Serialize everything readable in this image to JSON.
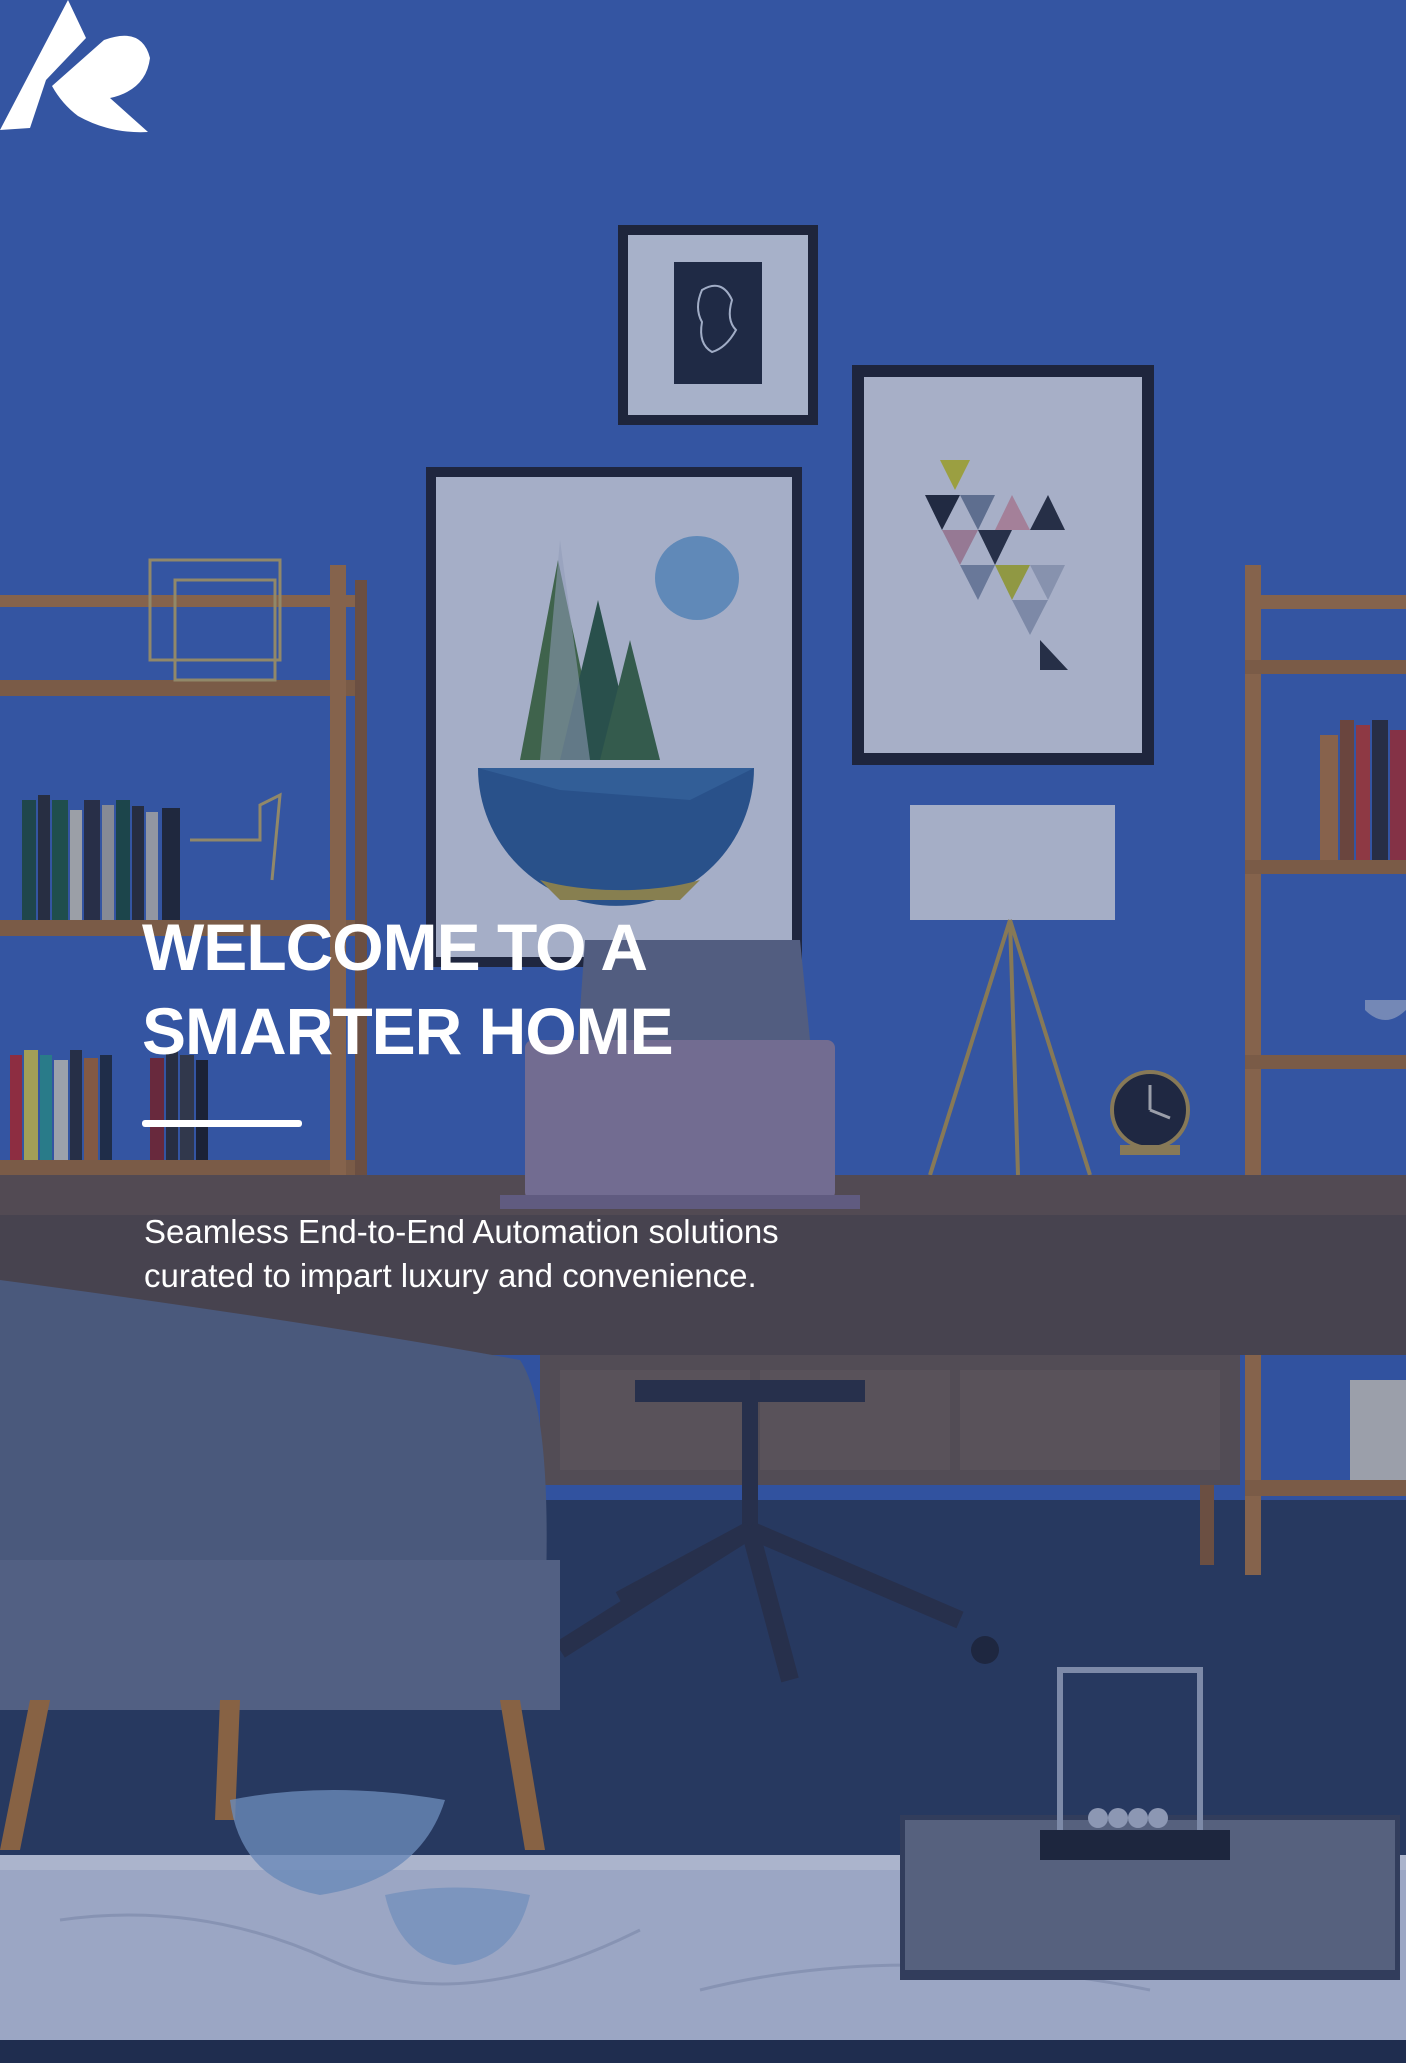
{
  "hero": {
    "headline_line1": "WELCOME TO A",
    "headline_line2": "SMARTER HOME",
    "tagline_line1": "Seamless End-to-End Automation solutions",
    "tagline_line2": "curated to impart luxury and convenience."
  },
  "logo": {
    "icon": "stylized-a-logo-icon"
  },
  "colors": {
    "wall": "#3a61b4",
    "desk": "#5b4a3e",
    "floor": "#2d3f5f",
    "text": "#ffffff"
  }
}
